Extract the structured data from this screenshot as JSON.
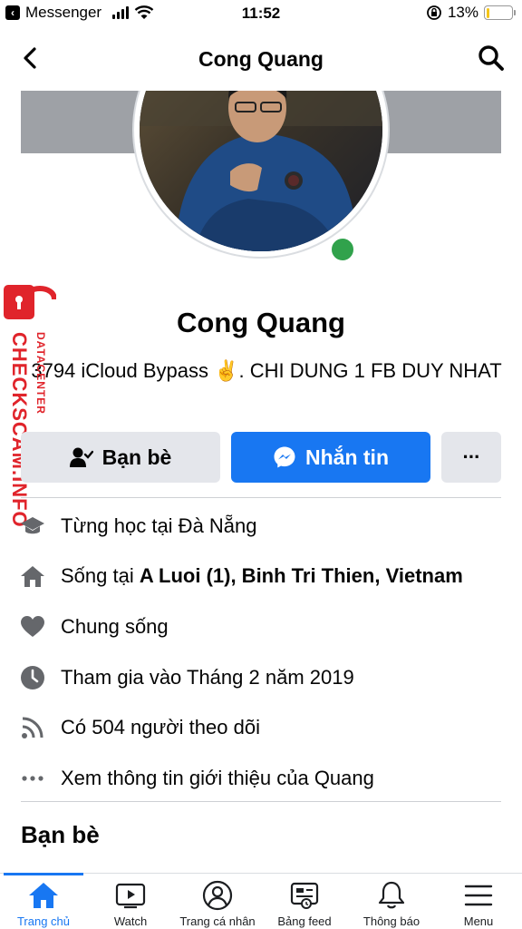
{
  "status_bar": {
    "back_app": "Messenger",
    "time": "11:52",
    "battery": "13%",
    "battery_level": 0.13,
    "icons": [
      "signal-icon",
      "wifi-icon",
      "rotation-lock-icon",
      "battery-icon"
    ]
  },
  "header": {
    "title": "Cong Quang"
  },
  "profile": {
    "name": "Cong Quang",
    "bio": "3794 iCloud Bypass ✌️.       CHI DUNG 1 FB DUY NHAT",
    "online": true
  },
  "actions": {
    "friends_label": "Bạn bè",
    "message_label": "Nhắn tin",
    "more_label": "···"
  },
  "info": [
    {
      "icon": "graduation-cap-icon",
      "text": "Từng học tại Đà Nẵng"
    },
    {
      "icon": "home-icon",
      "text": "Sống tại ",
      "bold": "A Luoi (1), Binh Tri Thien, Vietnam"
    },
    {
      "icon": "heart-icon",
      "text": "Chung sống"
    },
    {
      "icon": "clock-icon",
      "text": "Tham gia vào Tháng 2 năm 2019"
    },
    {
      "icon": "rss-icon",
      "text": "Có 504 người theo dõi"
    },
    {
      "icon": "more-dots-icon",
      "text": "Xem thông tin giới thiệu của Quang"
    }
  ],
  "friends_section": {
    "title": "Bạn bè"
  },
  "watermark": {
    "main": "CHECKSCAM.INFO",
    "sub": "DATACENTER"
  },
  "tabs": [
    {
      "label": "Trang chủ",
      "icon": "home-icon",
      "active": true
    },
    {
      "label": "Watch",
      "icon": "watch-play-icon",
      "active": false
    },
    {
      "label": "Trang cá nhân",
      "icon": "profile-icon",
      "active": false
    },
    {
      "label": "Bảng feed",
      "icon": "feed-icon",
      "active": false
    },
    {
      "label": "Thông báo",
      "icon": "bell-icon",
      "active": false
    },
    {
      "label": "Menu",
      "icon": "menu-icon",
      "active": false
    }
  ],
  "colors": {
    "accent": "#1877f2",
    "online": "#31a24c",
    "watermark": "#e0242b",
    "battery": "#f5c518"
  }
}
